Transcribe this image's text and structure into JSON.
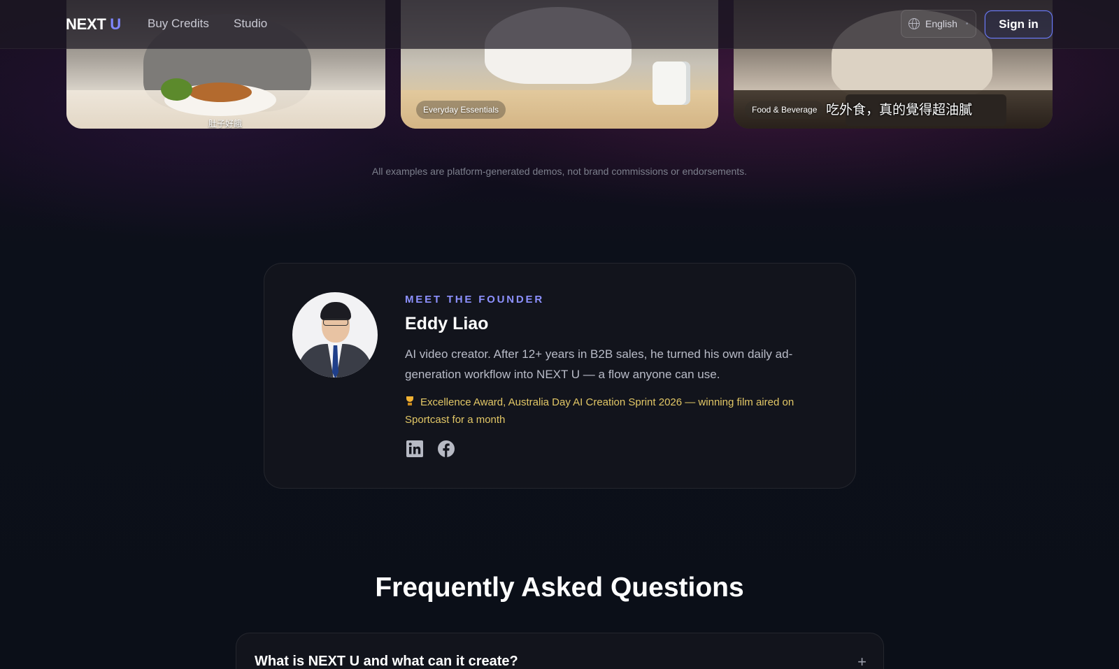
{
  "nav": {
    "logo_main": "NEXT",
    "logo_accent": "U",
    "links": [
      "Buy Credits",
      "Studio"
    ],
    "language": "English",
    "signin_label": "Sign in"
  },
  "video_cards": [
    {
      "caption": "肚子好餓"
    },
    {
      "tag": "Everyday Essentials"
    },
    {
      "tag": "Food & Beverage",
      "subtitle": "吃外食，真的覺得超油膩"
    }
  ],
  "disclaimer": "All examples are platform-generated demos, not brand commissions or endorsements.",
  "founder": {
    "label": "MEET THE FOUNDER",
    "name": "Eddy Liao",
    "bio": "AI video creator. After 12+ years in B2B sales, he turned his own daily ad-generation workflow into NEXT U — a flow anyone can use.",
    "award": "Excellence Award, Australia Day AI Creation Sprint 2026 — winning film aired on Sportcast for a month",
    "social": [
      "linkedin-icon",
      "facebook-icon"
    ]
  },
  "faq": {
    "title": "Frequently Asked Questions",
    "items": [
      {
        "question": "What is NEXT U and what can it create?"
      }
    ]
  },
  "colors": {
    "accent": "#7f86ff",
    "award": "#e2c766",
    "background": "#0b0f17",
    "card": "#12141c"
  }
}
